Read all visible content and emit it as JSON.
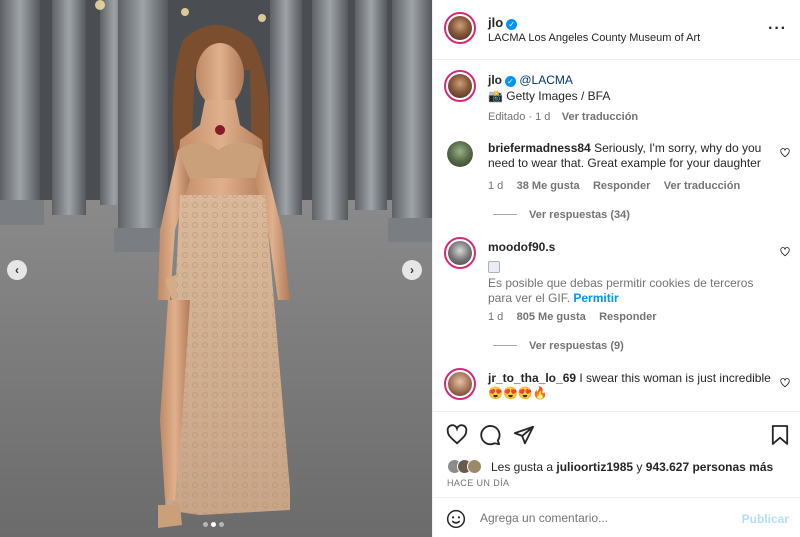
{
  "post": {
    "username": "jlo",
    "location": "LACMA Los Angeles County Museum of Art"
  },
  "caption": {
    "username": "jlo",
    "mention": "@LACMA",
    "emoji": "📸",
    "text": "Getty Images / BFA",
    "edited_time": "Editado · 1 d",
    "see_translation": "Ver traducción"
  },
  "comments": [
    {
      "username": "briefermadness84",
      "text": "Seriously, I'm sorry, why do you need to wear that. Great example for your daughter",
      "time": "1 d",
      "likes": "38 Me gusta",
      "reply": "Responder",
      "translation": "Ver traducción",
      "view_replies": "Ver respuestas (34)"
    },
    {
      "username": "moodof90.s",
      "gif_notice": "Es posible que debas permitir cookies de terceros para ver el GIF.",
      "gif_allow": "Permitir",
      "time": "1 d",
      "likes": "805 Me gusta",
      "reply": "Responder",
      "view_replies": "Ver respuestas (9)"
    },
    {
      "username": "jr_to_tha_lo_69",
      "text": "I swear this woman is just incredible 😍😍😍🔥"
    }
  ],
  "actions": {
    "liked_by_prefix": "Les gusta a",
    "liked_by_user": "julioortiz1985",
    "liked_by_mid": "y",
    "liked_by_count": "943.627 personas más",
    "timestamp": "HACE UN DÍA"
  },
  "add_comment": {
    "placeholder": "Agrega un comentario...",
    "publish": "Publicar"
  },
  "colors": {
    "accent": "#0095f6",
    "story_ring": "#d62976",
    "link": "#00376b"
  }
}
